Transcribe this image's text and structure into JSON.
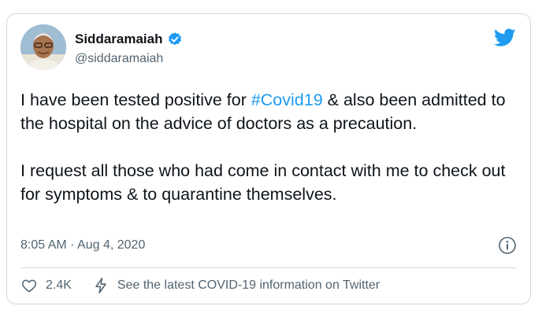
{
  "tweet": {
    "display_name": "Siddaramaiah",
    "handle": "@siddaramaiah",
    "verified": true,
    "body_before_hashtag": "I have been tested positive for ",
    "hashtag": "#Covid19",
    "body_after_hashtag": " & also been admitted to the hospital on the advice of doctors as a precaution.\n\nI request all those who had come in contact with me to check out for symptoms & to quarantine themselves.",
    "timestamp": "8:05 AM · Aug 4, 2020",
    "likes": "2.4K",
    "info_link": "See the latest COVID-19 information on Twitter"
  },
  "colors": {
    "accent": "#1d9bf0",
    "text": "#0f1419",
    "secondary": "#536471",
    "border": "#cfd9de"
  },
  "icons": {
    "brand": "twitter-bird-icon",
    "verified": "verified-badge-icon",
    "info": "info-icon",
    "like": "heart-icon",
    "covid": "lightning-icon"
  }
}
